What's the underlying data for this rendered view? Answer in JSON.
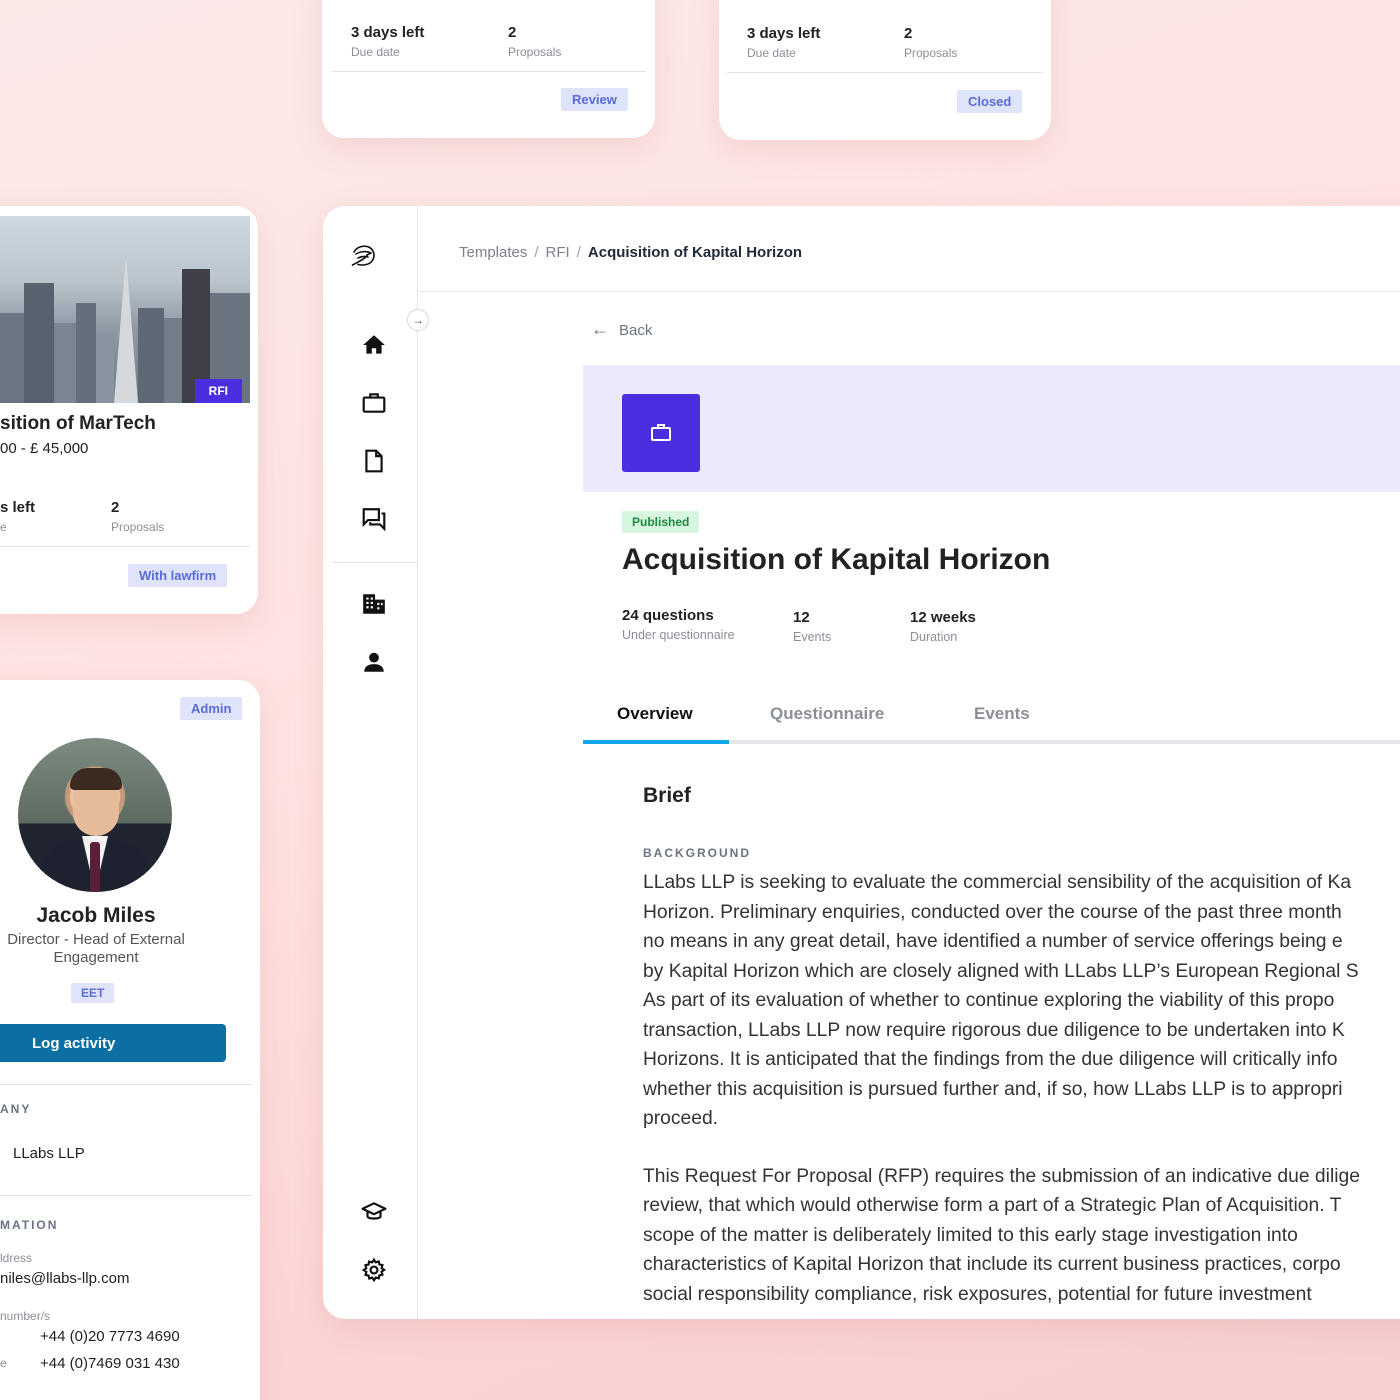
{
  "top_cards": [
    {
      "days_left": "3 days left",
      "due_label": "Due date",
      "proposals": "2",
      "proposals_label": "Proposals",
      "status": "Review"
    },
    {
      "days_left": "3 days left",
      "due_label": "Due date",
      "proposals": "2",
      "proposals_label": "Proposals",
      "status": "Closed"
    }
  ],
  "property_card": {
    "tag": "RFI",
    "title": "sition of MarTech",
    "budget": "00 - £ 45,000",
    "days_left": "s left",
    "due_label": "e",
    "proposals": "2",
    "proposals_label": "Proposals",
    "status": "With lawfirm"
  },
  "profile": {
    "role_badge": "Admin",
    "name": "Jacob Miles",
    "title_line1": "Director - Head of External",
    "title_line2": "Engagement",
    "timezone": "EET",
    "log_button": "Log activity",
    "company_heading": "ANY",
    "company": "LLabs LLP",
    "info_heading": "MATION",
    "email_label": "ldress",
    "email": "niles@llabs-llp.com",
    "phone_label": "number/s",
    "phone1": "+44 (0)20 7773 4690",
    "phone2_prefix": "e",
    "phone2": "+44 (0)7469 031 430"
  },
  "breadcrumb": {
    "items": [
      "Templates",
      "RFI"
    ],
    "separator": "/",
    "current": "Acquisition of Kapital Horizon"
  },
  "back_label": "Back",
  "rfp": {
    "status": "Published",
    "title": "Acquisition of Kapital Horizon",
    "stats": [
      {
        "value": "24 questions",
        "label": "Under questionnaire"
      },
      {
        "value": "12",
        "label": "Events"
      },
      {
        "value": "12 weeks",
        "label": "Duration"
      }
    ]
  },
  "tabs": [
    "Overview",
    "Questionnaire",
    "Events"
  ],
  "brief": {
    "heading": "Brief",
    "section": "BACKGROUND",
    "paragraph1": [
      "LLabs LLP is seeking to evaluate the commercial sensibility of the acquisition of Ka",
      "Horizon. Preliminary enquiries, conducted over the course of the past three month",
      "no means in any great detail, have identified a number of service offerings being e",
      "by Kapital Horizon which are closely aligned with LLabs LLP’s European Regional S",
      "As part of its evaluation of whether to continue exploring the viability of this propo",
      "transaction, LLabs LLP now require rigorous due diligence to be undertaken into K",
      "Horizons. It is anticipated that the findings from the due diligence will critically info",
      "whether this acquisition is pursued further and, if so, how LLabs LLP is to appropri",
      "proceed."
    ],
    "paragraph2": [
      "This Request For Proposal (RFP) requires the submission of an indicative due dilige",
      "review, that which would otherwise form a part of a Strategic Plan of Acquisition. T",
      "scope of the matter is deliberately limited to this early stage investigation into",
      "characteristics of Kapital Horizon that include its current business practices, corpo",
      "social responsibility compliance, risk exposures, potential for future investment"
    ]
  },
  "colors": {
    "accent_purple": "#4a2ee0",
    "banner_bg": "#ece9fd",
    "tab_underline": "#0ea5e9",
    "log_button": "#0b6fa4",
    "chip_bg": "#dfe4fb",
    "published_bg": "#d7f5df"
  }
}
